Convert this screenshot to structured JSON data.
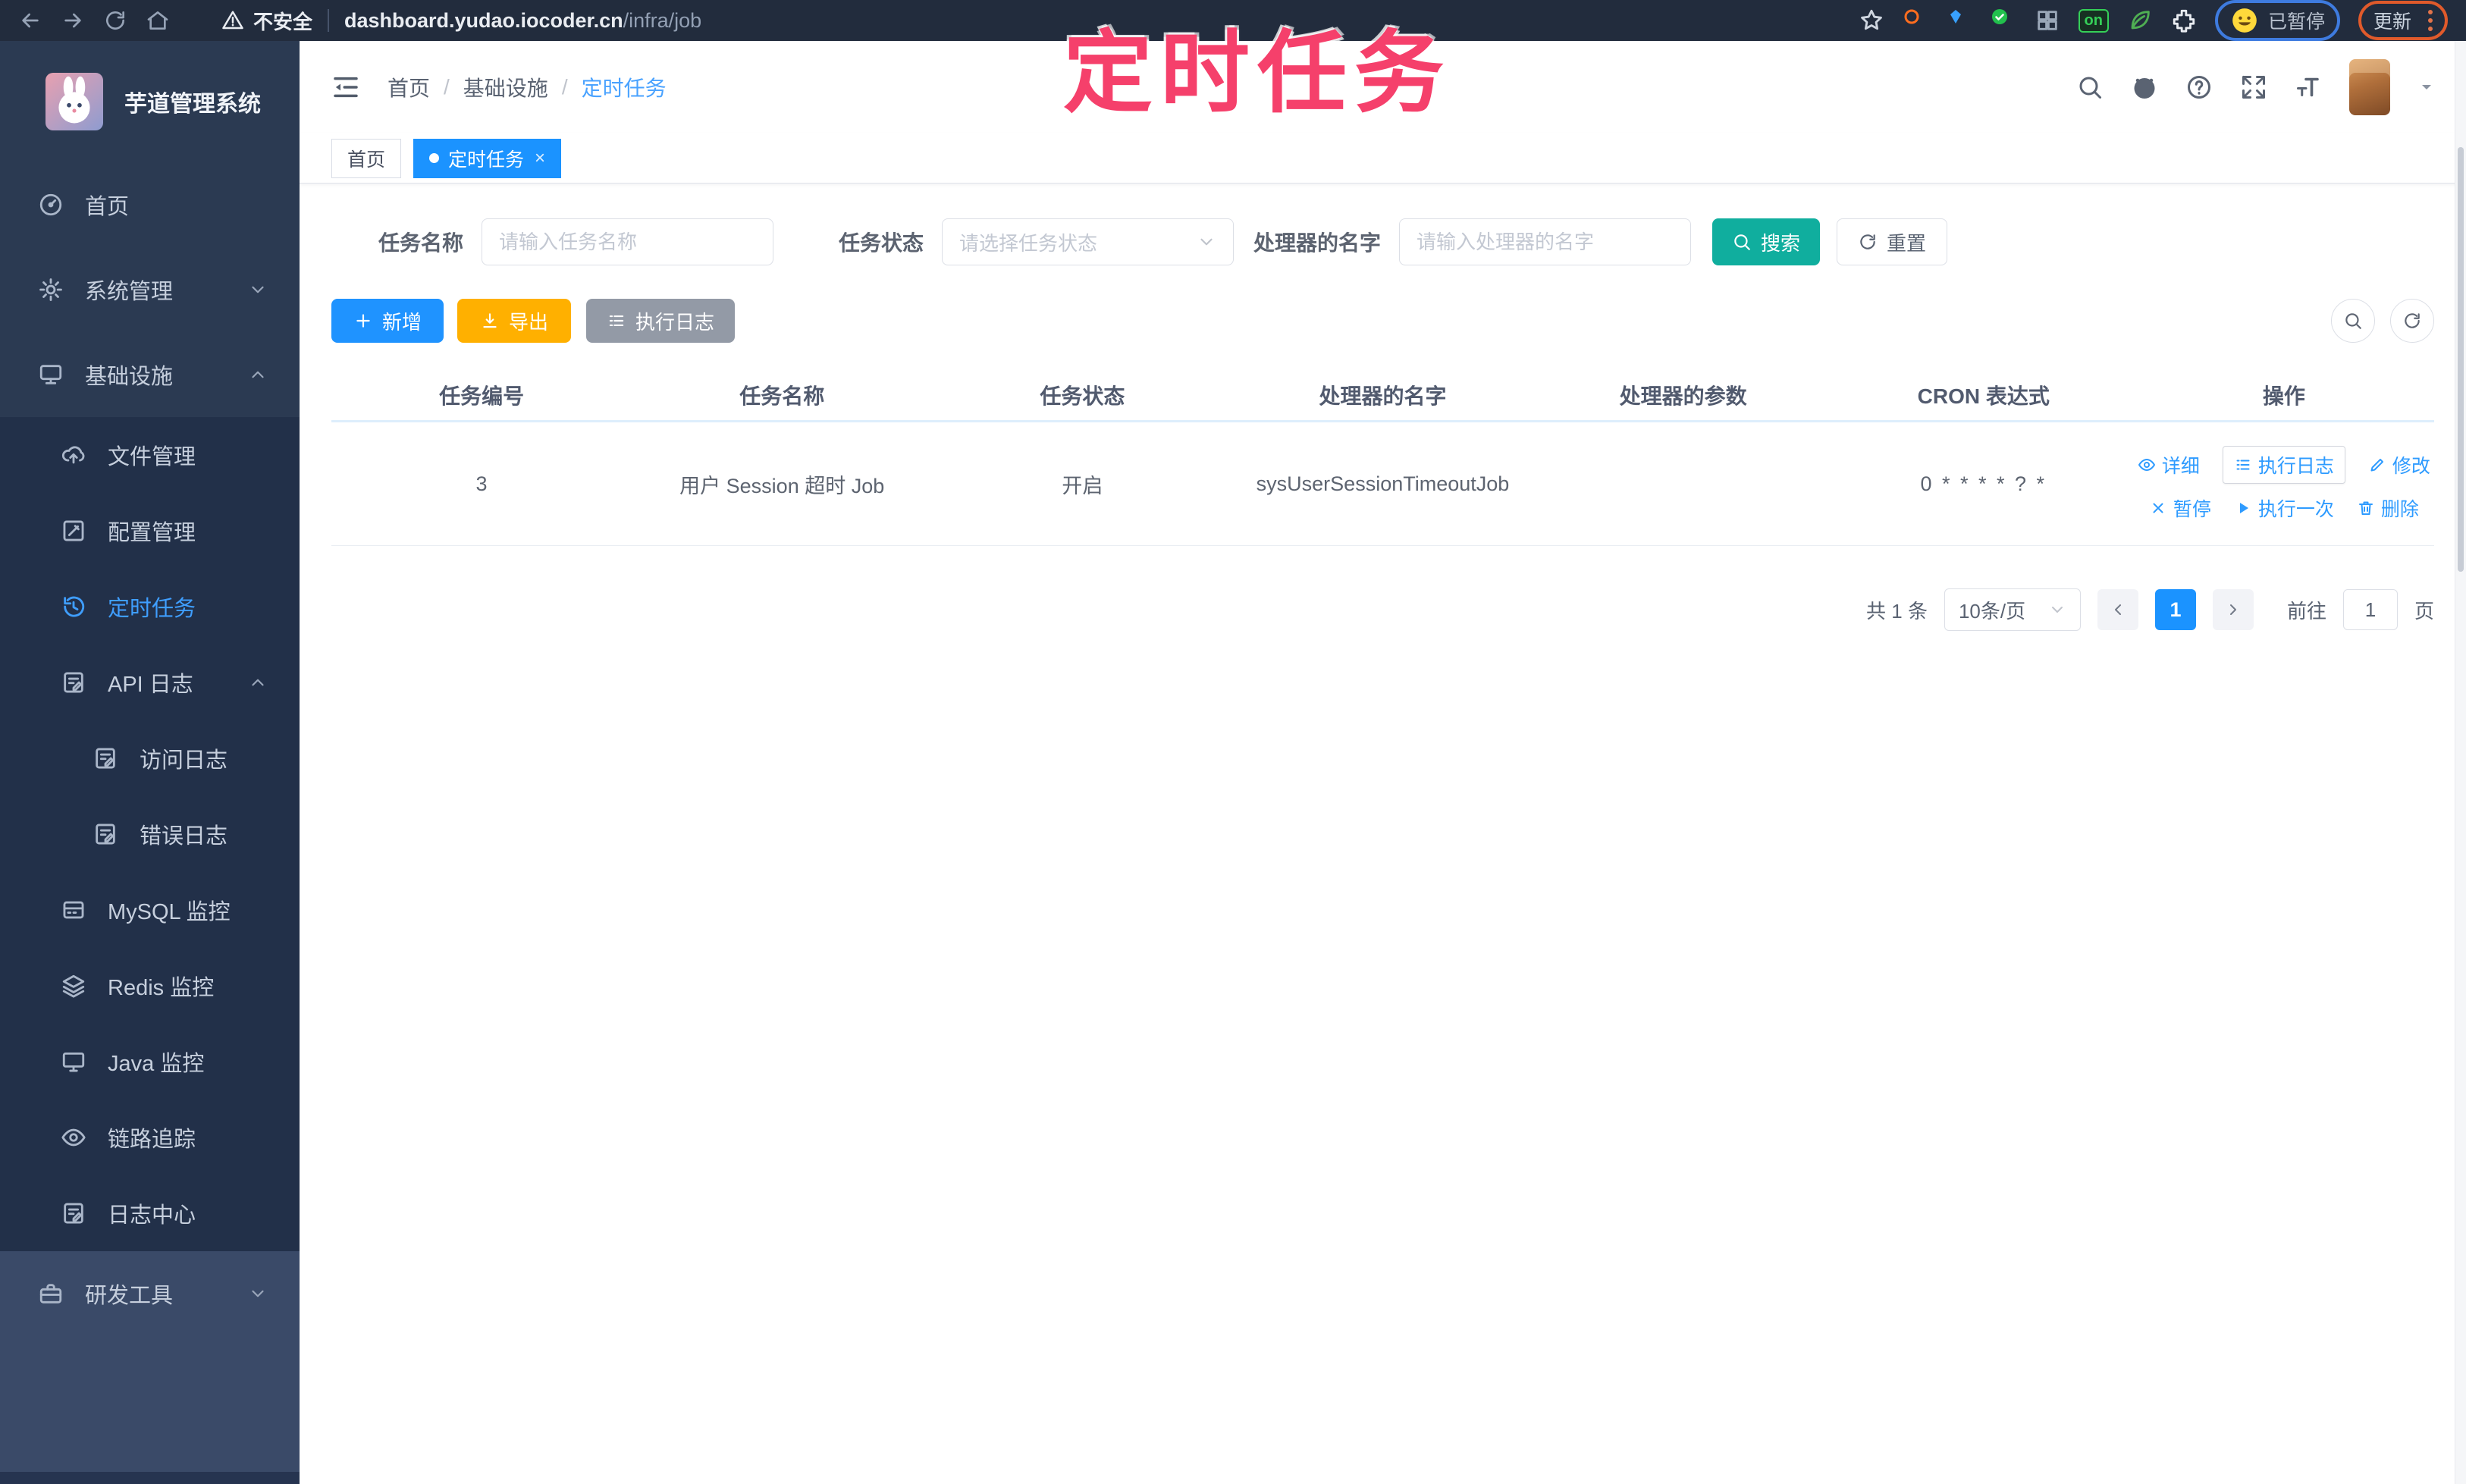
{
  "browser": {
    "security_label": "不安全",
    "url_host": "dashboard.yudao.iocoder.cn",
    "url_path": "/infra/job",
    "on_badge": "on",
    "profile_status": "已暂停",
    "update_label": "更新"
  },
  "annotation": {
    "title": "定时任务"
  },
  "sidebar": {
    "app_title": "芋道管理系统",
    "items": [
      {
        "label": "首页"
      },
      {
        "label": "系统管理"
      },
      {
        "label": "基础设施"
      },
      {
        "label": "文件管理"
      },
      {
        "label": "配置管理"
      },
      {
        "label": "定时任务",
        "active": true
      },
      {
        "label": "API 日志"
      },
      {
        "label": "访问日志"
      },
      {
        "label": "错误日志"
      },
      {
        "label": "MySQL 监控"
      },
      {
        "label": "Redis 监控"
      },
      {
        "label": "Java 监控"
      },
      {
        "label": "链路追踪"
      },
      {
        "label": "日志中心"
      },
      {
        "label": "研发工具"
      }
    ]
  },
  "header": {
    "breadcrumb": [
      "首页",
      "基础设施",
      "定时任务"
    ]
  },
  "tags": [
    {
      "label": "首页"
    },
    {
      "label": "定时任务",
      "close": "×"
    }
  ],
  "filters": {
    "name_label": "任务名称",
    "name_placeholder": "请输入任务名称",
    "status_label": "任务状态",
    "status_placeholder": "请选择任务状态",
    "handler_label": "处理器的名字",
    "handler_placeholder": "请输入处理器的名字",
    "search_label": "搜索",
    "reset_label": "重置"
  },
  "toolbar": {
    "add_label": "新增",
    "export_label": "导出",
    "exec_log_label": "执行日志"
  },
  "table": {
    "columns": [
      "任务编号",
      "任务名称",
      "任务状态",
      "处理器的名字",
      "处理器的参数",
      "CRON 表达式",
      "操作"
    ],
    "rows": [
      {
        "id": "3",
        "name": "用户 Session 超时 Job",
        "status": "开启",
        "handler": "sysUserSessionTimeoutJob",
        "param": "",
        "cron": "0 * * * * ? *",
        "actions_row1": [
          "详细",
          "执行日志",
          "修改"
        ],
        "actions_row2": [
          "暂停",
          "执行一次",
          "删除"
        ]
      }
    ]
  },
  "pagination": {
    "total": "共 1 条",
    "page_size": "10条/页",
    "current": "1",
    "goto_label": "前往",
    "goto_value": "1",
    "page_unit": "页"
  },
  "colors": {
    "accent_blue": "#1f93ff",
    "teal": "#10ae9e",
    "amber": "#ffb000",
    "gray_button": "#939aa6",
    "annotation_red": "#f5406b",
    "sidebar_bg": "#2b3a52",
    "submenu_bg": "#223049",
    "active_link": "#3f9eff"
  }
}
